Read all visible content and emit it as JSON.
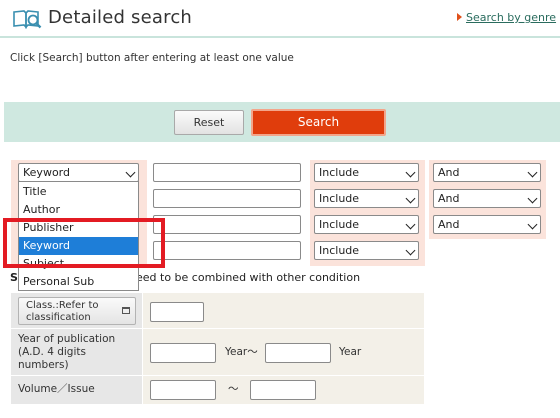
{
  "header": {
    "title": "Detailed search",
    "genre_link": "Search by genre"
  },
  "instruction": "Click [Search] button after entering at least one value",
  "buttons": {
    "reset": "Reset",
    "search": "Search"
  },
  "conditions": [
    {
      "field": "Keyword",
      "mode": "Include",
      "operator": "And"
    },
    {
      "field": "",
      "mode": "Include",
      "operator": "And"
    },
    {
      "field": "",
      "mode": "Include",
      "operator": "And"
    },
    {
      "field": "",
      "mode": "Include",
      "operator": ""
    }
  ],
  "dropdown": {
    "options": [
      "Title",
      "Author",
      "Publisher",
      "Keyword",
      "Subject",
      "Personal Sub"
    ],
    "selected": "Keyword"
  },
  "note": {
    "prefix": "S",
    "suffix": "leed to be combined with other condition"
  },
  "filters": {
    "classification_button": "Class.:Refer to classification",
    "year_label": "Year of publication (A.D. 4 digits numbers)",
    "year_from_suffix": "Year〜",
    "year_to_suffix": "Year",
    "volume_label": "Volume／Issue",
    "volume_separator": "〜"
  },
  "colors": {
    "accent_orange": "#e03d0c",
    "band_green": "#cfe8e0",
    "selection_blue": "#1e7ed8",
    "highlight_red": "#e31b23"
  }
}
